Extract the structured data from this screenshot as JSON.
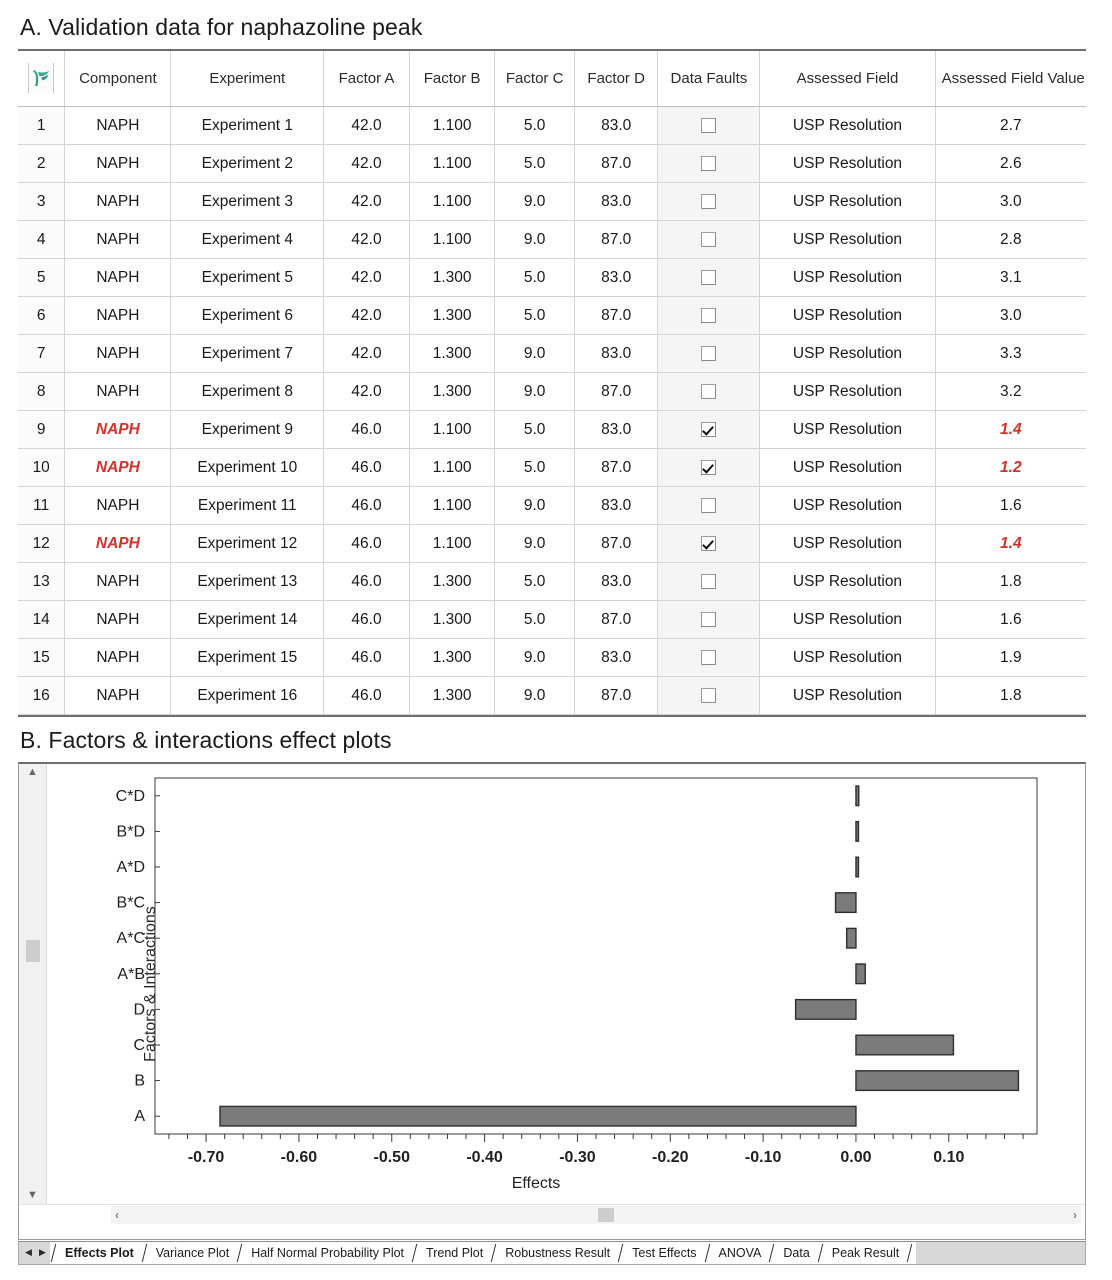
{
  "sections": {
    "a_title": "A. Validation data for naphazoline peak",
    "b_title": "B. Factors & interactions effect plots"
  },
  "table": {
    "corner_icon": "app-logo-icon",
    "columns": [
      "Component",
      "Experiment",
      "Factor A",
      "Factor B",
      "Factor C",
      "Factor D",
      "Data Faults",
      "Assessed Field",
      "Assessed Field Value"
    ],
    "rows": [
      {
        "n": "1",
        "component": "NAPH",
        "experiment": "Experiment 1",
        "a": "42.0",
        "b": "1.100",
        "c": "5.0",
        "d": "83.0",
        "fault": false,
        "field": "USP Resolution",
        "value": "2.7",
        "flagged": false
      },
      {
        "n": "2",
        "component": "NAPH",
        "experiment": "Experiment 2",
        "a": "42.0",
        "b": "1.100",
        "c": "5.0",
        "d": "87.0",
        "fault": false,
        "field": "USP Resolution",
        "value": "2.6",
        "flagged": false
      },
      {
        "n": "3",
        "component": "NAPH",
        "experiment": "Experiment 3",
        "a": "42.0",
        "b": "1.100",
        "c": "9.0",
        "d": "83.0",
        "fault": false,
        "field": "USP Resolution",
        "value": "3.0",
        "flagged": false
      },
      {
        "n": "4",
        "component": "NAPH",
        "experiment": "Experiment 4",
        "a": "42.0",
        "b": "1.100",
        "c": "9.0",
        "d": "87.0",
        "fault": false,
        "field": "USP Resolution",
        "value": "2.8",
        "flagged": false
      },
      {
        "n": "5",
        "component": "NAPH",
        "experiment": "Experiment 5",
        "a": "42.0",
        "b": "1.300",
        "c": "5.0",
        "d": "83.0",
        "fault": false,
        "field": "USP Resolution",
        "value": "3.1",
        "flagged": false
      },
      {
        "n": "6",
        "component": "NAPH",
        "experiment": "Experiment 6",
        "a": "42.0",
        "b": "1.300",
        "c": "5.0",
        "d": "87.0",
        "fault": false,
        "field": "USP Resolution",
        "value": "3.0",
        "flagged": false
      },
      {
        "n": "7",
        "component": "NAPH",
        "experiment": "Experiment 7",
        "a": "42.0",
        "b": "1.300",
        "c": "9.0",
        "d": "83.0",
        "fault": false,
        "field": "USP Resolution",
        "value": "3.3",
        "flagged": false
      },
      {
        "n": "8",
        "component": "NAPH",
        "experiment": "Experiment 8",
        "a": "42.0",
        "b": "1.300",
        "c": "9.0",
        "d": "87.0",
        "fault": false,
        "field": "USP Resolution",
        "value": "3.2",
        "flagged": false
      },
      {
        "n": "9",
        "component": "NAPH",
        "experiment": "Experiment 9",
        "a": "46.0",
        "b": "1.100",
        "c": "5.0",
        "d": "83.0",
        "fault": true,
        "field": "USP Resolution",
        "value": "1.4",
        "flagged": true
      },
      {
        "n": "10",
        "component": "NAPH",
        "experiment": "Experiment 10",
        "a": "46.0",
        "b": "1.100",
        "c": "5.0",
        "d": "87.0",
        "fault": true,
        "field": "USP Resolution",
        "value": "1.2",
        "flagged": true
      },
      {
        "n": "11",
        "component": "NAPH",
        "experiment": "Experiment 11",
        "a": "46.0",
        "b": "1.100",
        "c": "9.0",
        "d": "83.0",
        "fault": false,
        "field": "USP Resolution",
        "value": "1.6",
        "flagged": false
      },
      {
        "n": "12",
        "component": "NAPH",
        "experiment": "Experiment 12",
        "a": "46.0",
        "b": "1.100",
        "c": "9.0",
        "d": "87.0",
        "fault": true,
        "field": "USP Resolution",
        "value": "1.4",
        "flagged": true
      },
      {
        "n": "13",
        "component": "NAPH",
        "experiment": "Experiment 13",
        "a": "46.0",
        "b": "1.300",
        "c": "5.0",
        "d": "83.0",
        "fault": false,
        "field": "USP Resolution",
        "value": "1.8",
        "flagged": false
      },
      {
        "n": "14",
        "component": "NAPH",
        "experiment": "Experiment 14",
        "a": "46.0",
        "b": "1.300",
        "c": "5.0",
        "d": "87.0",
        "fault": false,
        "field": "USP Resolution",
        "value": "1.6",
        "flagged": false
      },
      {
        "n": "15",
        "component": "NAPH",
        "experiment": "Experiment 15",
        "a": "46.0",
        "b": "1.300",
        "c": "9.0",
        "d": "83.0",
        "fault": false,
        "field": "USP Resolution",
        "value": "1.9",
        "flagged": false
      },
      {
        "n": "16",
        "component": "NAPH",
        "experiment": "Experiment 16",
        "a": "46.0",
        "b": "1.300",
        "c": "9.0",
        "d": "87.0",
        "fault": false,
        "field": "USP Resolution",
        "value": "1.8",
        "flagged": false
      }
    ]
  },
  "chart_data": {
    "type": "bar",
    "orientation": "horizontal",
    "title": "",
    "xlabel": "Effects",
    "ylabel": "Factors & Interactions",
    "categories": [
      "C*D",
      "B*D",
      "A*D",
      "B*C",
      "A*C",
      "A*B",
      "D",
      "C",
      "B",
      "A"
    ],
    "values": [
      0.003,
      0.001,
      0.0,
      -0.022,
      -0.01,
      0.01,
      -0.065,
      0.105,
      0.175,
      -0.685
    ],
    "xlim": [
      -0.755,
      0.195
    ],
    "xticks": [
      -0.7,
      -0.6,
      -0.5,
      -0.4,
      -0.3,
      -0.2,
      -0.1,
      0.0,
      0.1
    ],
    "xticklabels": [
      "-0.70",
      "-0.60",
      "-0.50",
      "-0.40",
      "-0.30",
      "-0.20",
      "-0.10",
      "0.00",
      "0.10"
    ],
    "minor_ticks_per_interval": 5,
    "grid": false,
    "legend": null,
    "bar_fill": "#7b7b7b",
    "bar_stroke": "#2e2e2e"
  },
  "scrollbars": {
    "vertical_up": "▲",
    "vertical_down": "▼",
    "horizontal_left": "‹",
    "horizontal_right": "›"
  },
  "tabbar": {
    "nav_prev": "◀",
    "nav_next": "▶",
    "tabs": [
      {
        "label": "Effects Plot",
        "active": true
      },
      {
        "label": "Variance Plot",
        "active": false
      },
      {
        "label": "Half Normal Probability Plot",
        "active": false
      },
      {
        "label": "Trend Plot",
        "active": false
      },
      {
        "label": "Robustness Result",
        "active": false
      },
      {
        "label": "Test Effects",
        "active": false
      },
      {
        "label": "ANOVA",
        "active": false
      },
      {
        "label": "Data",
        "active": false
      },
      {
        "label": "Peak Result",
        "active": false
      }
    ]
  },
  "colors": {
    "flag_red": "#d3322c",
    "logo_teal": "#2e9e86",
    "bar_gray": "#7b7b7b"
  }
}
